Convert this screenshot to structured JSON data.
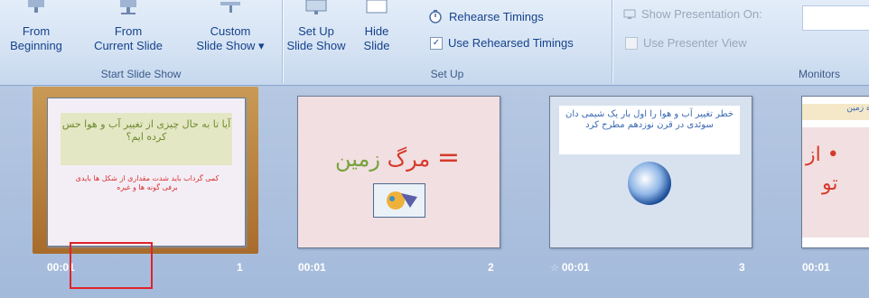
{
  "ribbon": {
    "start_slide_show": {
      "label": "Start Slide Show",
      "from_beginning": "From\nBeginning",
      "from_current": "From\nCurrent Slide",
      "custom": "Custom\nSlide Show ▾"
    },
    "set_up": {
      "label": "Set Up",
      "set_up_show": "Set Up\nSlide Show",
      "hide_slide": "Hide\nSlide",
      "rehearse": "Rehearse Timings",
      "use_rehearsed": "Use Rehearsed Timings",
      "use_rehearsed_checked": true
    },
    "monitors": {
      "label": "Monitors",
      "show_on": "Show Presentation On:",
      "presenter_view": "Use Presenter View"
    }
  },
  "slides": [
    {
      "time": "00:01",
      "number": "1",
      "title": "آیا تا به حال چیزی از تغییر آب و هوا حس کرده ایم؟",
      "body": "کمی گرداب باید شدت مقداری از شکل ها بایدی برفی گونه ها و غیره"
    },
    {
      "time": "00:01",
      "number": "2",
      "title_part1": "مرگ",
      "title_part2": "زمین",
      "equals": "="
    },
    {
      "time": "00:01",
      "number": "3",
      "title": "خطر تغییر آب و هوا را اول بار یک شیمی دان سوئدی در قرن نوزدهم مطرح کرد"
    },
    {
      "time": "00:01",
      "title": "ره زمین",
      "bullet": "• از",
      "line2": "تو"
    }
  ]
}
